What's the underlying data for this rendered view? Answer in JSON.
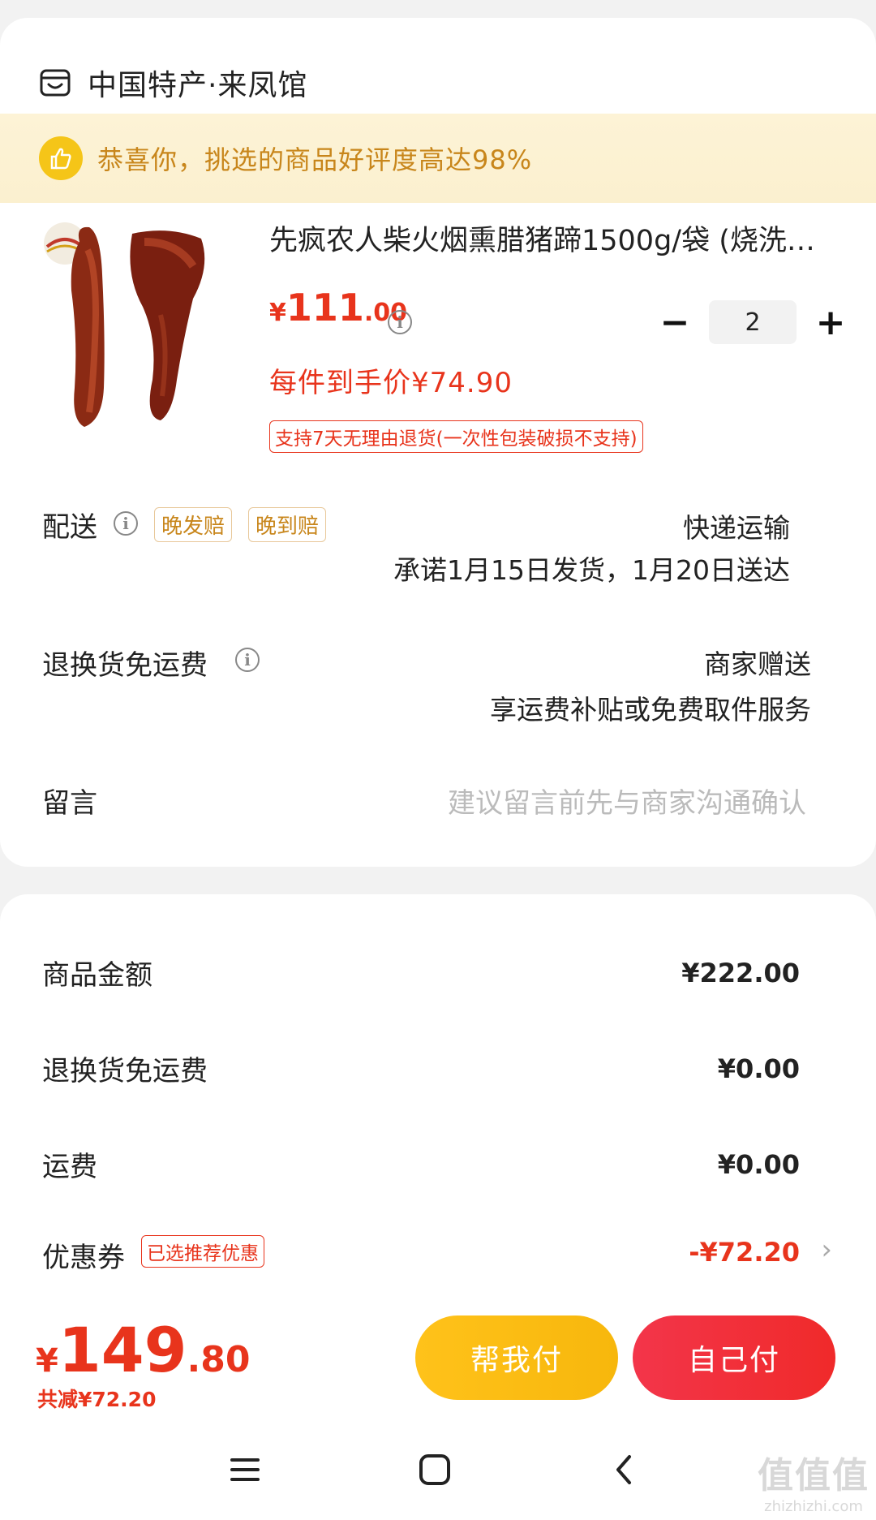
{
  "store": {
    "name": "中国特产·来凤馆",
    "icon": "store-icon"
  },
  "banner": {
    "text": "恭喜你，挑选的商品好评度高达98%",
    "icon": "thumbs-up-icon"
  },
  "product": {
    "title": "先疯农人柴火烟熏腊猪蹄1500g/袋 (烧洗…",
    "price_symbol": "¥",
    "price_int": "111",
    "price_dec": ".00",
    "quantity": "2",
    "unit_price": "每件到手价¥74.90",
    "return_policy": "支持7天无理由退货(一次性包装破损不支持)"
  },
  "delivery": {
    "label": "配送",
    "tags": [
      "晚发赔",
      "晚到赔"
    ],
    "method": "快递运输",
    "promise": "承诺1月15日发货，1月20日送达"
  },
  "return_shipping": {
    "label": "退换货免运费",
    "value": "商家赠送",
    "desc": "享运费补贴或免费取件服务"
  },
  "message": {
    "label": "留言",
    "placeholder": "建议留言前先与商家沟通确认"
  },
  "summary": {
    "goods_label": "商品金额",
    "goods_value": "¥222.00",
    "return_label": "退换货免运费",
    "return_value": "¥0.00",
    "shipping_label": "运费",
    "shipping_value": "¥0.00",
    "coupon_label": "优惠券",
    "coupon_tag": "已选推荐优惠",
    "coupon_value": "-¥72.20"
  },
  "footer": {
    "total_symbol": "¥",
    "total_int": "149",
    "total_dec": ".80",
    "saved": "共减¥72.20",
    "help_pay": "帮我付",
    "self_pay": "自己付"
  },
  "watermark": {
    "big": "值值值",
    "small": "zhizhizhi.com"
  },
  "colors": {
    "accent_red": "#e8341c",
    "banner_gold": "#c8861b",
    "help_yellow": "#ffc21a",
    "pay_red": "#f02a2a"
  }
}
